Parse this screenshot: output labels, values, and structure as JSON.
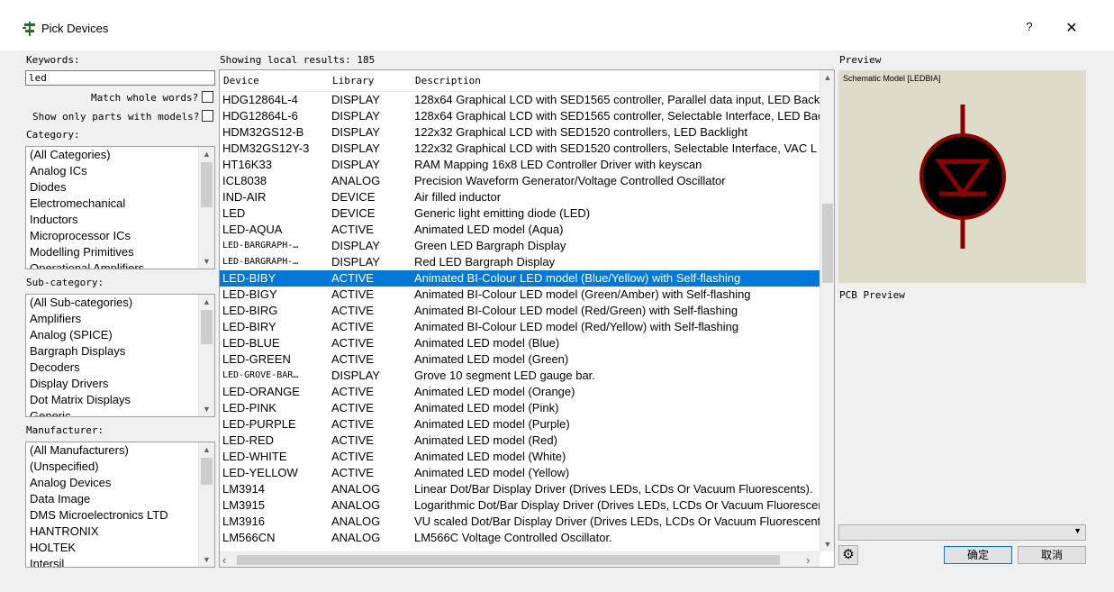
{
  "window": {
    "title": "Pick Devices",
    "help": "?",
    "close": "✕"
  },
  "keywords": {
    "label": "Keywords:",
    "value": "led"
  },
  "options": {
    "match_whole_words": "Match whole words?",
    "show_only_models": "Show only parts with models?"
  },
  "category": {
    "label": "Category:",
    "items": [
      "(All Categories)",
      "Analog ICs",
      "Diodes",
      "Electromechanical",
      "Inductors",
      "Microprocessor ICs",
      "Modelling Primitives",
      "Operational Amplifiers"
    ]
  },
  "subcategory": {
    "label": "Sub-category:",
    "items": [
      "(All Sub-categories)",
      "Amplifiers",
      "Analog (SPICE)",
      "Bargraph Displays",
      "Decoders",
      "Display Drivers",
      "Dot Matrix Displays",
      "Generic"
    ]
  },
  "manufacturer": {
    "label": "Manufacturer:",
    "items": [
      "(All Manufacturers)",
      "(Unspecified)",
      "Analog Devices",
      "Data Image",
      "DMS Microelectronics LTD",
      "HANTRONIX",
      "HOLTEK",
      "Intersil"
    ]
  },
  "results": {
    "label": "Showing local results: 185",
    "columns": [
      "Device",
      "Library",
      "Description"
    ],
    "rows": [
      [
        "HDG12864L-4",
        "DISPLAY",
        "128x64 Graphical LCD with SED1565 controller, Parallel data input, LED Backl"
      ],
      [
        "HDG12864L-6",
        "DISPLAY",
        "128x64 Graphical LCD with SED1565 controller, Selectable Interface, LED Bac"
      ],
      [
        "HDM32GS12-B",
        "DISPLAY",
        "122x32 Graphical LCD with SED1520 controllers, LED Backlight"
      ],
      [
        "HDM32GS12Y-3",
        "DISPLAY",
        "122x32 Graphical LCD with SED1520 controllers, Selectable Interface, VAC L"
      ],
      [
        "HT16K33",
        "DISPLAY",
        "RAM Mapping 16x8 LED Controller Driver with keyscan"
      ],
      [
        "ICL8038",
        "ANALOG",
        "Precision Waveform Generator/Voltage Controlled Oscillator"
      ],
      [
        "IND-AIR",
        "DEVICE",
        "Air filled inductor"
      ],
      [
        "LED",
        "DEVICE",
        "Generic light emitting diode (LED)"
      ],
      [
        "LED-AQUA",
        "ACTIVE",
        "Animated LED model (Aqua)"
      ],
      [
        "LED-BARGRAPH-…",
        "DISPLAY",
        "Green LED Bargraph Display"
      ],
      [
        "LED-BARGRAPH-…",
        "DISPLAY",
        "Red LED Bargraph Display"
      ],
      [
        "LED-BIBY",
        "ACTIVE",
        "Animated BI-Colour LED model (Blue/Yellow) with Self-flashing"
      ],
      [
        "LED-BIGY",
        "ACTIVE",
        "Animated BI-Colour LED model (Green/Amber) with Self-flashing"
      ],
      [
        "LED-BIRG",
        "ACTIVE",
        "Animated BI-Colour LED model (Red/Green) with Self-flashing"
      ],
      [
        "LED-BIRY",
        "ACTIVE",
        "Animated BI-Colour LED model (Red/Yellow) with Self-flashing"
      ],
      [
        "LED-BLUE",
        "ACTIVE",
        "Animated LED model (Blue)"
      ],
      [
        "LED-GREEN",
        "ACTIVE",
        "Animated LED model (Green)"
      ],
      [
        "LED-GROVE-BAR…",
        "DISPLAY",
        "Grove 10 segment LED gauge bar."
      ],
      [
        "LED-ORANGE",
        "ACTIVE",
        "Animated LED model (Orange)"
      ],
      [
        "LED-PINK",
        "ACTIVE",
        "Animated LED model (Pink)"
      ],
      [
        "LED-PURPLE",
        "ACTIVE",
        "Animated LED model (Purple)"
      ],
      [
        "LED-RED",
        "ACTIVE",
        "Animated LED model (Red)"
      ],
      [
        "LED-WHITE",
        "ACTIVE",
        "Animated LED model (White)"
      ],
      [
        "LED-YELLOW",
        "ACTIVE",
        "Animated LED model (Yellow)"
      ],
      [
        "LM3914",
        "ANALOG",
        "Linear Dot/Bar Display Driver (Drives LEDs, LCDs Or Vacuum Fluorescents)."
      ],
      [
        "LM3915",
        "ANALOG",
        "Logarithmic Dot/Bar Display Driver (Drives LEDs, LCDs Or Vacuum Fluorescen"
      ],
      [
        "LM3916",
        "ANALOG",
        "VU scaled Dot/Bar Display Driver (Drives LEDs, LCDs Or Vacuum Fluorescents"
      ],
      [
        "LM566CN",
        "ANALOG",
        "LM566C Voltage Controlled Oscillator."
      ]
    ]
  },
  "preview": {
    "label": "Preview",
    "model_label": "Schematic Model [LEDBIA]",
    "symbol_color": "#8b0000"
  },
  "pcb_preview": {
    "label": "PCB Preview"
  },
  "footer": {
    "ok": "确定",
    "cancel": "取消"
  },
  "colors": {
    "selection": "#0078d7"
  }
}
